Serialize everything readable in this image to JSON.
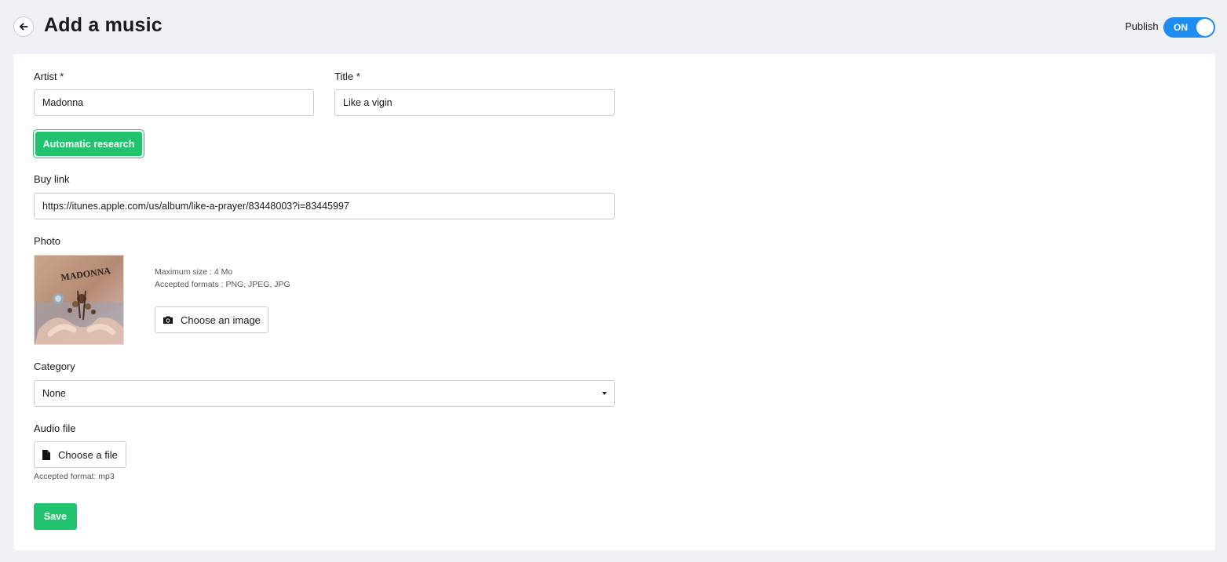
{
  "header": {
    "title": "Add a music",
    "back_icon": "arrow-left-icon",
    "publish_label": "Publish",
    "publish_toggle": "ON"
  },
  "form": {
    "artist": {
      "label": "Artist *",
      "value": "Madonna"
    },
    "title": {
      "label": "Title *",
      "value": "Like a vigin"
    },
    "research_button": "Automatic research",
    "buy_link": {
      "label": "Buy link",
      "value": "https://itunes.apple.com/us/album/like-a-prayer/83448003?i=83445997"
    },
    "photo": {
      "label": "Photo",
      "cover_text": "MADONNA",
      "max_size": "Maximum size : 4 Mo",
      "formats": "Accepted formats : PNG, JPEG, JPG",
      "choose_button": "Choose an image",
      "choose_icon": "camera-icon"
    },
    "category": {
      "label": "Category",
      "value": "None",
      "icon": "caret-down-icon"
    },
    "audio": {
      "label": "Audio file",
      "choose_button": "Choose a file",
      "choose_icon": "file-icon",
      "format_hint": "Accepted format: mp3"
    },
    "save_button": "Save"
  },
  "colors": {
    "background": "#f0f1f5",
    "accent_green": "#22c36e",
    "toggle_blue": "#1f8cf0"
  }
}
